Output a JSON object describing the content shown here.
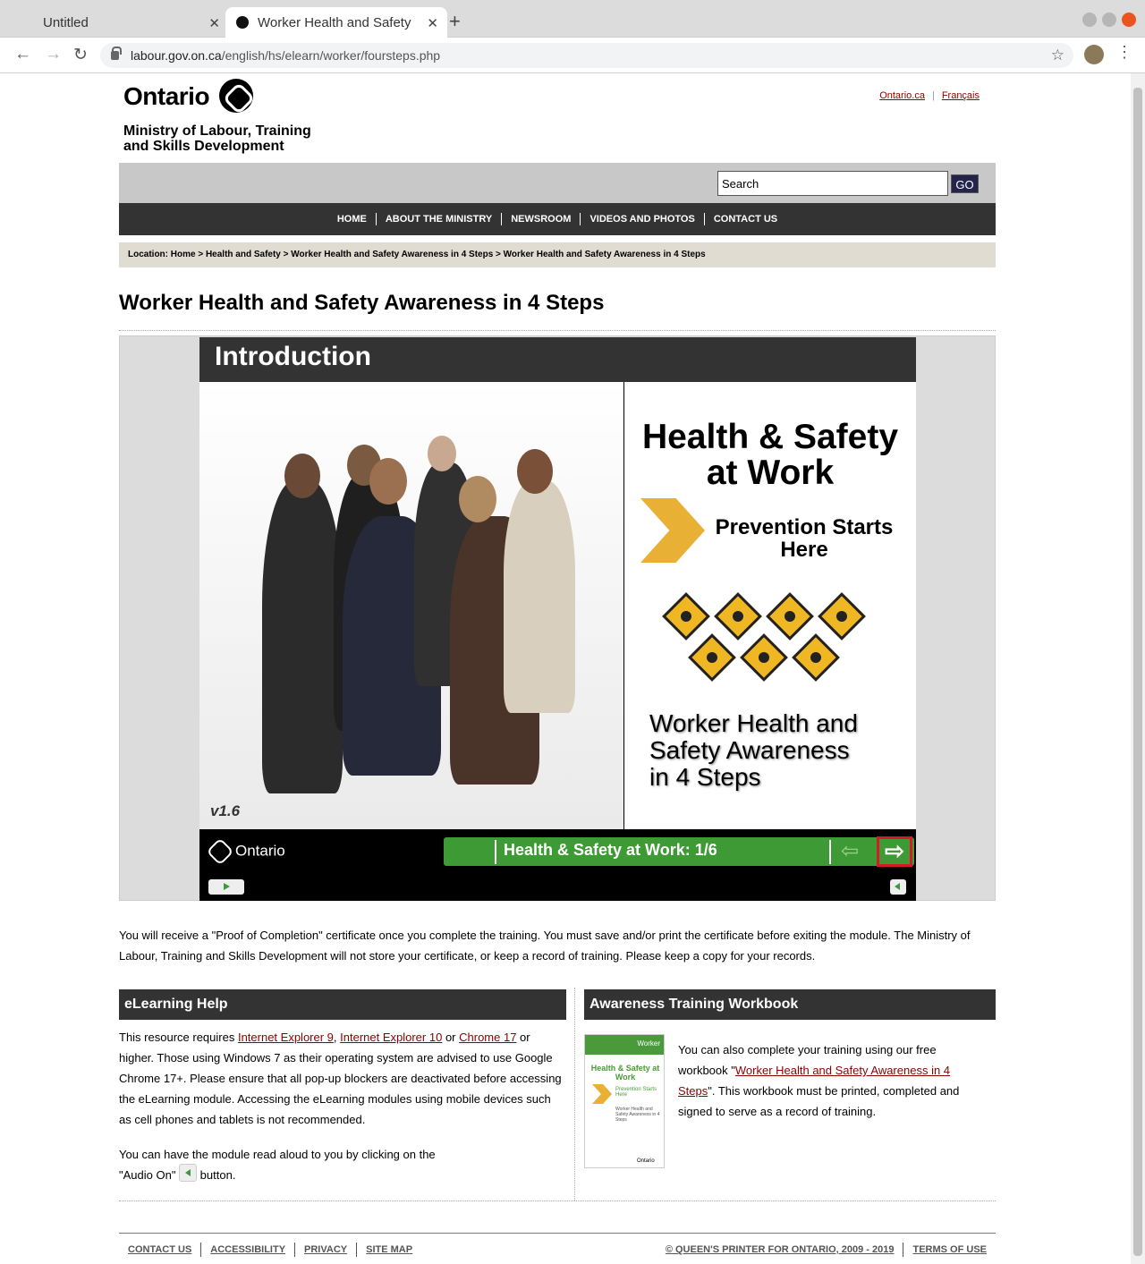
{
  "browser": {
    "tabs": [
      {
        "title": "Untitled"
      },
      {
        "title": "Worker Health and Safety"
      }
    ],
    "url_host": "labour.gov.on.ca",
    "url_path": "/english/hs/elearn/worker/foursteps.php"
  },
  "header": {
    "logo_text": "Ontario",
    "ministry_line1": "Ministry of Labour, Training",
    "ministry_line2": "and Skills Development",
    "links": [
      "Ontario.ca",
      "Français"
    ]
  },
  "search": {
    "value": "Search",
    "button": "GO"
  },
  "nav": [
    "HOME",
    "ABOUT THE MINISTRY",
    "NEWSROOM",
    "VIDEOS AND PHOTOS",
    "CONTACT US"
  ],
  "breadcrumb": "Location: Home > Health and Safety >  Worker Health and Safety Awareness in 4 Steps > Worker Health and Safety Awareness in 4 Steps",
  "page_title": "Worker Health and Safety Awareness in 4 Steps",
  "module": {
    "header": "Introduction",
    "version": "v1.6",
    "cover_title": "Health & Safety at Work",
    "prevention": "Prevention Starts Here",
    "subtitle_line1": "Worker Health and",
    "subtitle_line2": "Safety Awareness",
    "subtitle_line3": "in 4 Steps",
    "footer_logo": "Ontario",
    "progress_label": "Health & Safety at Work: 1/6"
  },
  "intro_paragraph": "You will receive a \"Proof of Completion\" certificate once you complete the training. You must save and/or print the certificate before exiting the module. The Ministry of Labour, Training and Skills Development will not store your certificate, or keep a record of training. Please keep a copy for your records.",
  "help": {
    "title": "eLearning Help",
    "text_before": "This resource requires ",
    "link1": "Internet Explorer 9",
    "comma": ", ",
    "link2": "Internet Explorer 10",
    "or": " or ",
    "link3": "Chrome 17",
    "text_after": " or higher. Those using Windows 7 as their operating system are advised to use Google Chrome 17+. Please ensure that all pop-up blockers are deactivated before accessing the eLearning module. Accessing the eLearning modules using mobile devices such as cell phones and tablets is not recommended.",
    "audio_before": "You can have the module read aloud to you by clicking on the \"Audio On\"",
    "audio_after": " button."
  },
  "workbook": {
    "title": "Awareness Training Workbook",
    "text_before": "You can also complete your training using our free workbook \"",
    "link": "Worker Health and Safety Awareness in 4 Steps",
    "text_after": "\". This workbook must be printed, completed and signed to serve as a record of training.",
    "cover_band": "Worker",
    "cover_title": "Health & Safety at Work",
    "cover_sub": "Prevention Starts Here",
    "cover_small": "Worker Health and Safety Awareness in 4 Steps",
    "cover_logo": "Ontario"
  },
  "footer": {
    "left_links": [
      "CONTACT US",
      "ACCESSIBILITY",
      "PRIVACY",
      "SITE MAP"
    ],
    "copyright": "© QUEEN'S PRINTER FOR ONTARIO, 2009 - 2019",
    "terms": "TERMS OF USE"
  },
  "colors": {
    "nav_bg": "#333333",
    "accent_green": "#3e9a35",
    "link_red": "#8b0000",
    "chevron_gold": "#e8b136"
  }
}
